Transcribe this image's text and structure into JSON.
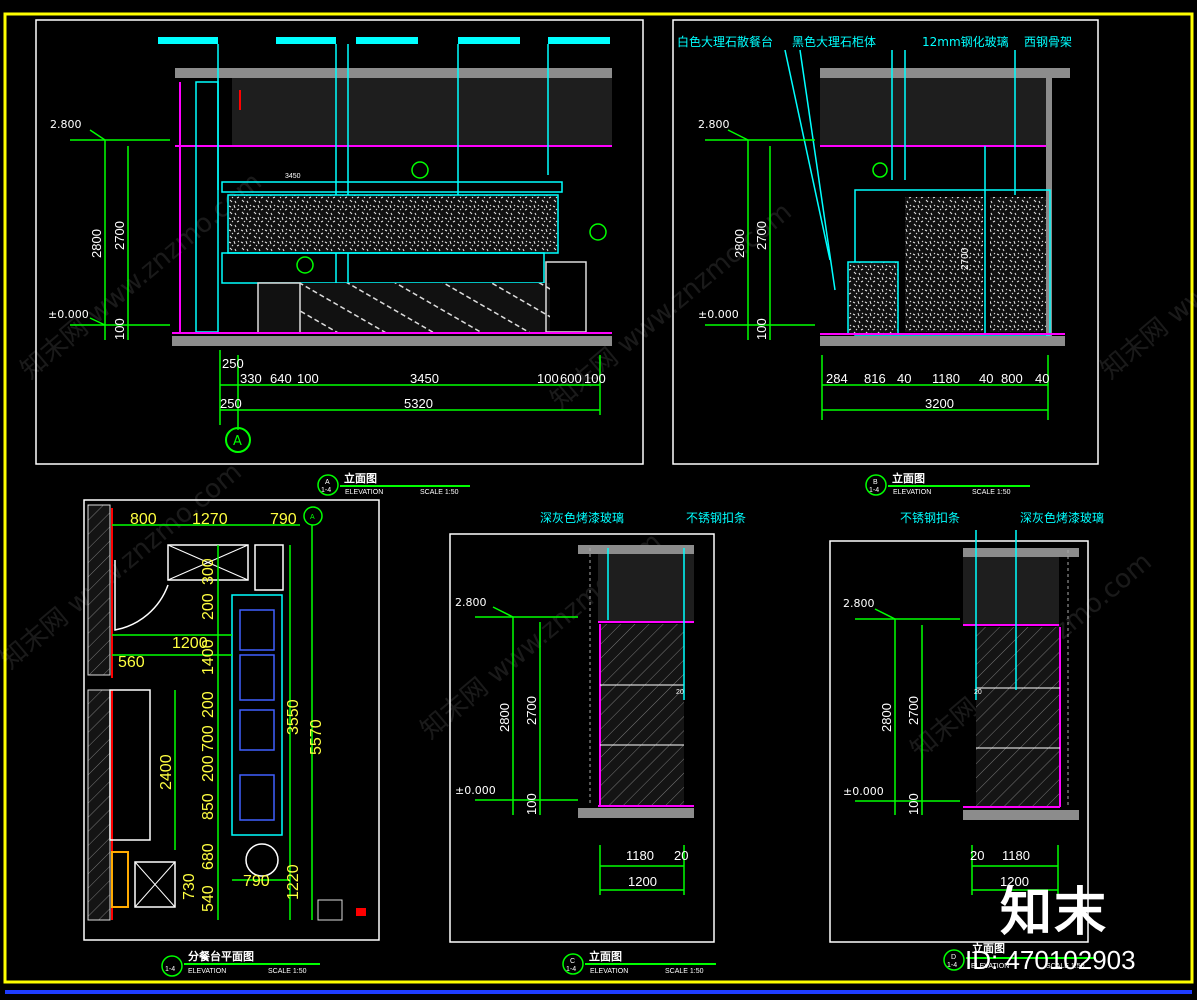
{
  "panelA": {
    "levels": [
      "2.800",
      "±0.000"
    ],
    "vdims": [
      "2800",
      "2700",
      "100"
    ],
    "hdims_top": [
      "250",
      "330",
      "640",
      "100",
      "3450",
      "100",
      "600",
      "100"
    ],
    "hdims_total": [
      "250",
      "5320"
    ],
    "small_dim": "3450",
    "marker": "A",
    "caption": "立面图",
    "caption_index": "A",
    "caption_sheet": "1-4",
    "elevation_label": "ELEVATION",
    "scale": "SCALE 1:50"
  },
  "panelB": {
    "levels": [
      "2.800",
      "±0.000"
    ],
    "vdims": [
      "2800",
      "2700",
      "100"
    ],
    "inner_dim": "2700",
    "callouts": [
      "白色大理石散餐台",
      "黑色大理石柜体",
      "12mm钢化玻璃",
      "西钢骨架"
    ],
    "hdims_top": [
      "284",
      "816",
      "40",
      "1180",
      "40",
      "800",
      "40"
    ],
    "hdims_total": "3200",
    "caption": "立面图",
    "caption_index": "B",
    "caption_sheet": "1-4",
    "elevation_label": "ELEVATION",
    "scale": "SCALE 1:50"
  },
  "plan": {
    "hdims": [
      "800",
      "1270",
      "790"
    ],
    "marker": "A",
    "vdims": [
      "300",
      "200",
      "1400",
      "200",
      "700",
      "200",
      "850",
      "680",
      "540"
    ],
    "dim_1200": "1200",
    "dim_560": "560",
    "dim_2400": "2400",
    "dim_3550": "3550",
    "dim_5570": "5570",
    "dim_730": "730",
    "dim_790b": "790",
    "dim_1220": "1220",
    "caption": "分餐台平面图",
    "caption_sheet": "1-4",
    "elevation_label": "ELEVATION",
    "scale": "SCALE 1:50"
  },
  "panelC": {
    "callouts": [
      "深灰色烤漆玻璃",
      "不锈钢扣条"
    ],
    "levels": [
      "2.800",
      "±0.000"
    ],
    "vdims": [
      "2800",
      "2700",
      "100"
    ],
    "mark20": "20",
    "hdims": [
      "1180",
      "20"
    ],
    "total": "1200",
    "caption": "立面图",
    "caption_index": "C",
    "caption_sheet": "1-4",
    "elevation_label": "ELEVATION",
    "scale": "SCALE 1:50"
  },
  "panelD": {
    "callouts": [
      "不锈钢扣条",
      "深灰色烤漆玻璃"
    ],
    "levels": [
      "2.800",
      "±0.000"
    ],
    "vdims": [
      "2800",
      "2700",
      "100"
    ],
    "mark20": "20",
    "hdims": [
      "20",
      "1180"
    ],
    "total": "1200",
    "caption": "立面图",
    "caption_index": "D",
    "caption_sheet": "1-4",
    "elevation_label": "ELEVATION",
    "scale": "SCALE 1:50"
  },
  "watermark": "知末网 www.znzmo.com",
  "brand": "知末",
  "id_text": "ID: 470102903",
  "colors": {
    "frame": "#ffff00",
    "border": "#ffffff",
    "cyan": "#00ffff",
    "green": "#00ff00",
    "magenta": "#ff00ff",
    "red": "#ff0000",
    "fill": "#1e1e1e",
    "gray": "#8c8c8c"
  }
}
